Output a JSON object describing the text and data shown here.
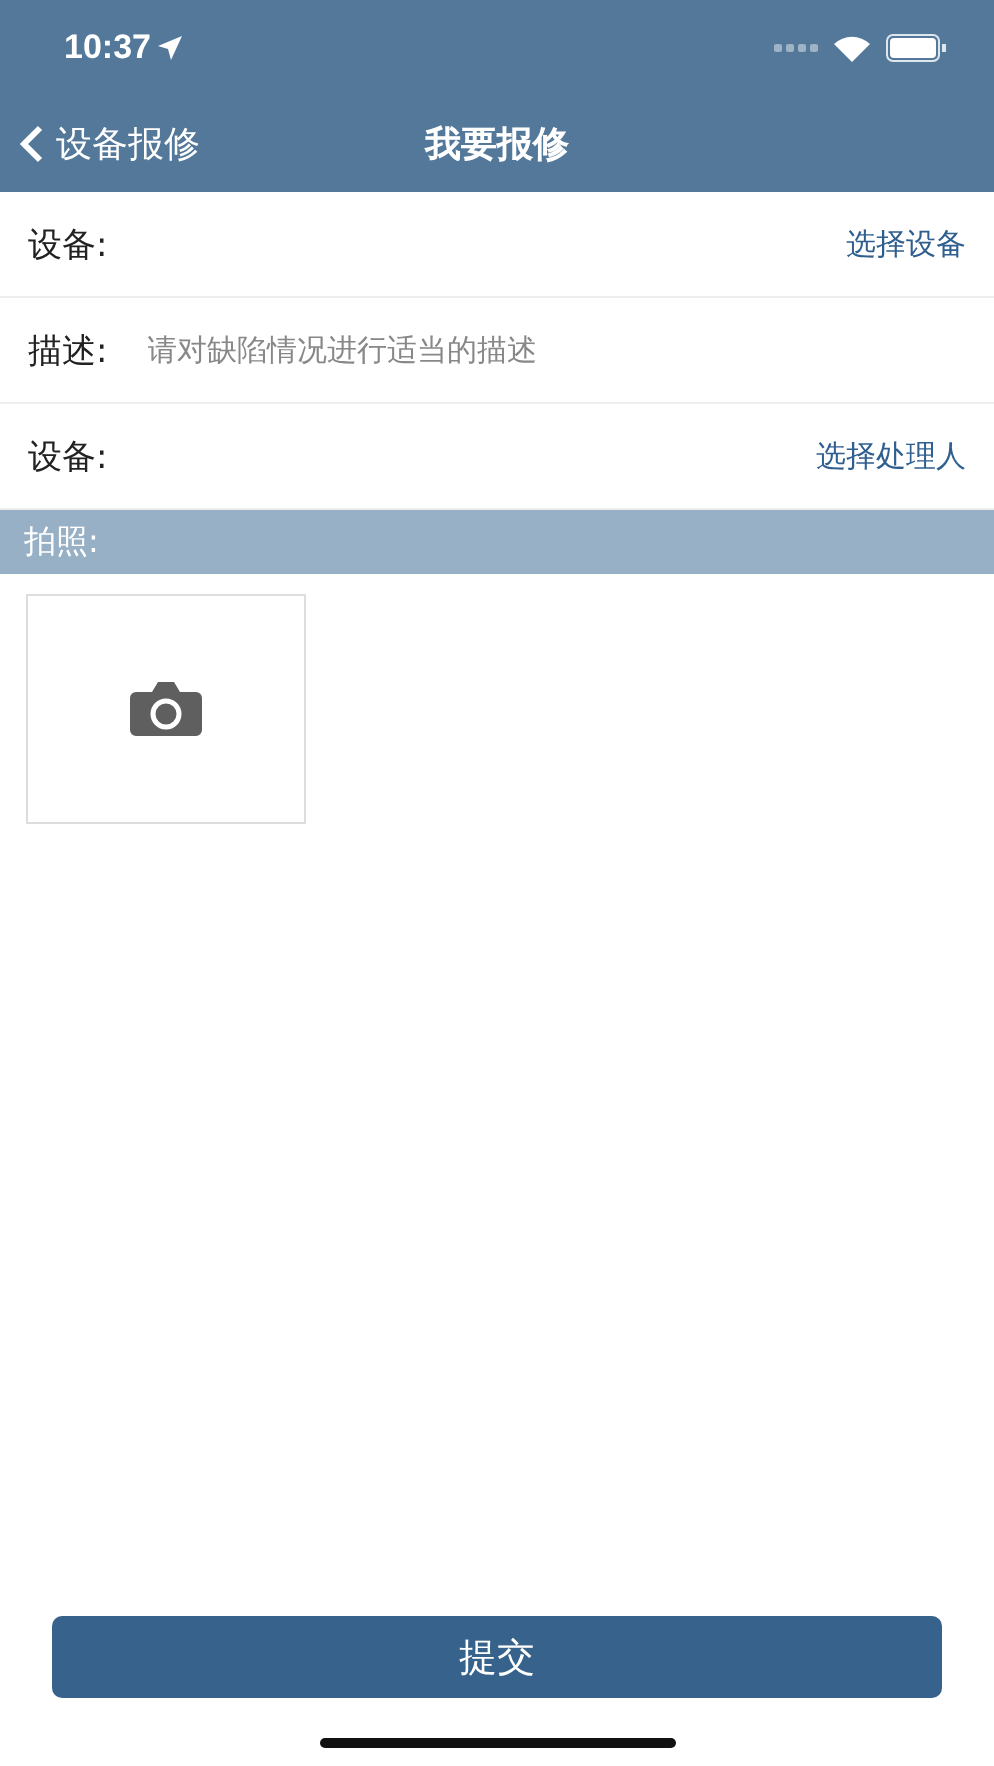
{
  "status_bar": {
    "time": "10:37"
  },
  "nav": {
    "back_label": "设备报修",
    "title": "我要报修"
  },
  "form_rows": [
    {
      "kind": "picker",
      "label": "设备:",
      "action": "选择设备"
    },
    {
      "kind": "input",
      "label": "描述:",
      "placeholder": "请对缺陷情况进行适当的描述"
    },
    {
      "kind": "picker",
      "label": "设备:",
      "action": "选择处理人"
    }
  ],
  "photo_section": {
    "title": "拍照:"
  },
  "submit_button": "提交"
}
